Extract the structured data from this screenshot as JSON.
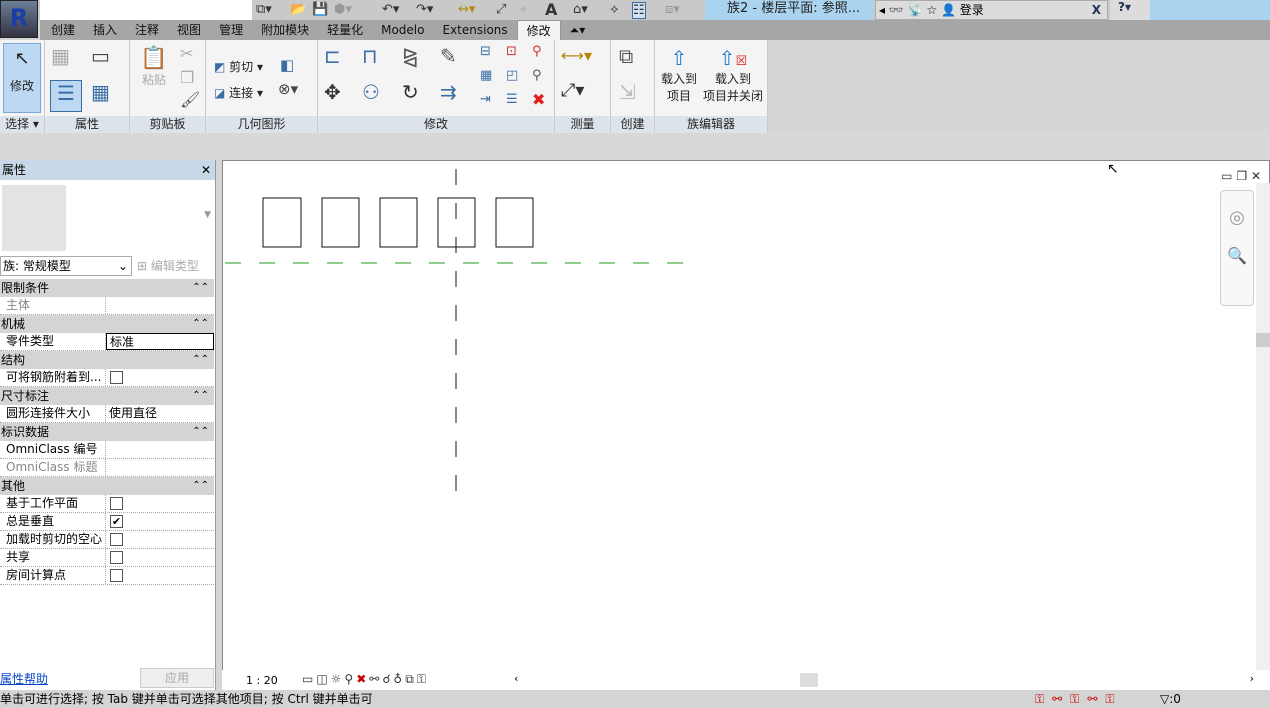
{
  "app": {
    "logo": "R",
    "title": "族2 - 楼层平面: 参照...",
    "search_placeholder": "",
    "login": "登录"
  },
  "tabs": [
    "创建",
    "插入",
    "注释",
    "视图",
    "管理",
    "附加模块",
    "轻量化",
    "Modelo",
    "Extensions",
    "修改"
  ],
  "active_tab": "修改",
  "ribbon": {
    "panels": [
      "选择",
      "属性",
      "剪贴板",
      "几何图形",
      "修改",
      "测量",
      "创建",
      "族编辑器"
    ],
    "modify_btn": "修改",
    "paste_btn": "粘贴",
    "cut_btn": "剪切",
    "join_btn": "连接",
    "load_project": [
      "载入到",
      "项目"
    ],
    "load_close": [
      "载入到",
      "项目并关闭"
    ]
  },
  "properties": {
    "title": "属性",
    "type_selector": "族: 常规模型",
    "edit_type": "编辑类型",
    "groups": [
      {
        "name": "限制条件",
        "rows": [
          {
            "key": "主体",
            "value": "",
            "dim": true
          }
        ]
      },
      {
        "name": "机械",
        "rows": [
          {
            "key": "零件类型",
            "value": "标准"
          }
        ]
      },
      {
        "name": "结构",
        "rows": [
          {
            "key": "可将钢筋附着到...",
            "checkbox": false
          }
        ]
      },
      {
        "name": "尺寸标注",
        "rows": [
          {
            "key": "圆形连接件大小",
            "value": "使用直径"
          }
        ]
      },
      {
        "name": "标识数据",
        "rows": [
          {
            "key": "OmniClass 编号",
            "value": ""
          },
          {
            "key": "OmniClass 标题",
            "value": "",
            "dim": true
          }
        ]
      },
      {
        "name": "其他",
        "rows": [
          {
            "key": "基于工作平面",
            "checkbox": false
          },
          {
            "key": "总是垂直",
            "checkbox": true
          },
          {
            "key": "加载时剪切的空心",
            "checkbox": false
          },
          {
            "key": "共享",
            "checkbox": false
          },
          {
            "key": "房间计算点",
            "checkbox": false
          }
        ]
      }
    ],
    "help_link": "属性帮助",
    "apply_btn": "应用"
  },
  "viewbar": {
    "scale": "1 : 20"
  },
  "status": "单击可进行选择; 按 Tab 键并单击可选择其他项目; 按 Ctrl 键并单击可",
  "status_filter_count": ":0",
  "colors": {
    "accent": "#3a6ea5",
    "ref_plane": "#1a9a1a",
    "title_bar": "#a9d3ee"
  }
}
